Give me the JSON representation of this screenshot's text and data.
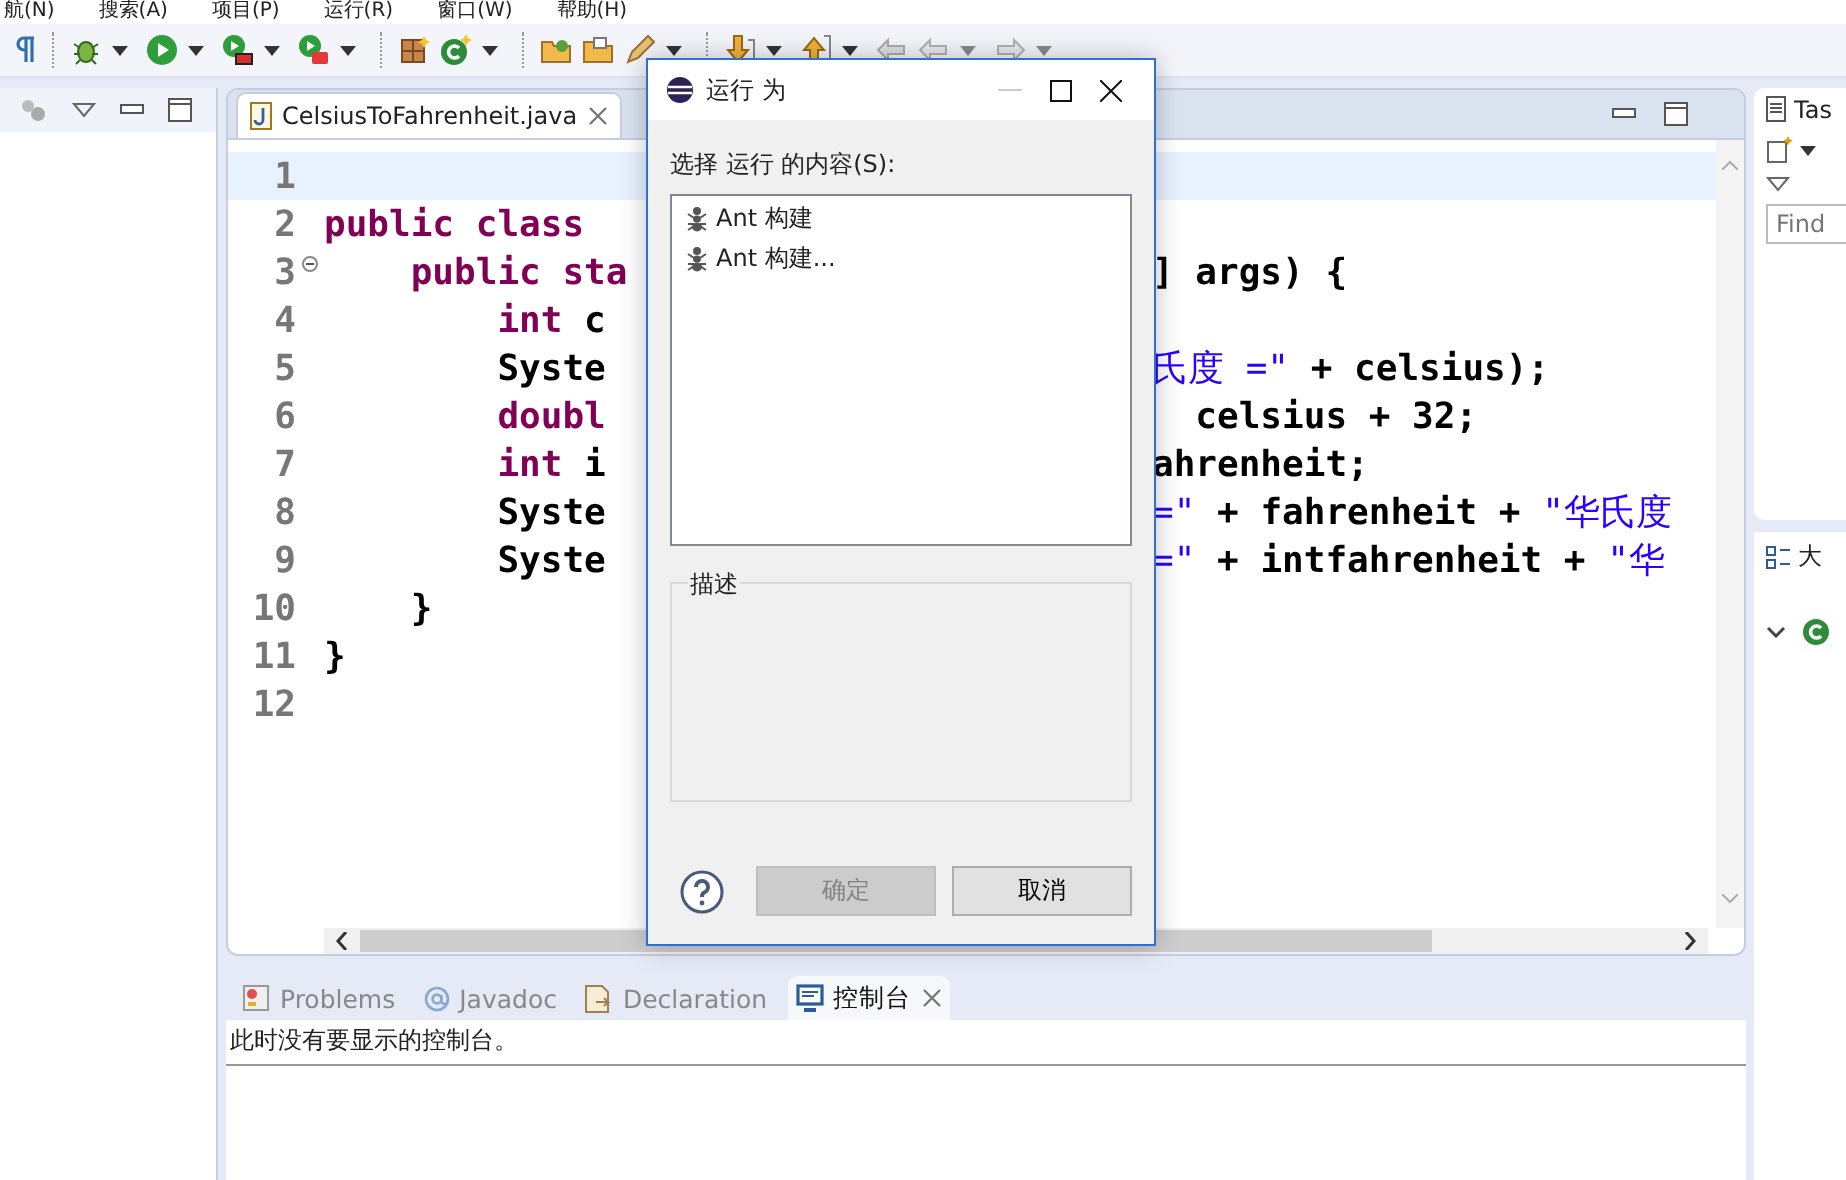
{
  "menu_bar": [
    "航(N)",
    "搜索(A)",
    "项目(P)",
    "运行(R)",
    "窗口(W)",
    "帮助(H)"
  ],
  "editor": {
    "tabs": [
      {
        "label": "CelsiusToFahrenheit.java",
        "selected": true
      }
    ],
    "lines": [
      {
        "number": "1",
        "current": true
      },
      {
        "number": "2",
        "current": false,
        "left": [
          {
            "kind": "keyword",
            "text": "public class"
          }
        ]
      },
      {
        "number": "3",
        "current": false,
        "folded": false,
        "left": [
          {
            "kind": "keyword",
            "text": "    public sta"
          }
        ],
        "right": [
          {
            "kind": "plain",
            "text": "] args) {"
          }
        ]
      },
      {
        "number": "4",
        "current": false,
        "left": [
          {
            "kind": "keyword",
            "text": "        int"
          },
          {
            "kind": "plain",
            "text": " c"
          }
        ]
      },
      {
        "number": "5",
        "current": false,
        "left": [
          {
            "kind": "plain",
            "text": "        Syste"
          }
        ],
        "right": [
          {
            "kind": "string",
            "text": "氏度 =\""
          },
          {
            "kind": "plain",
            "text": " + celsius);"
          }
        ]
      },
      {
        "number": "6",
        "current": false,
        "left": [
          {
            "kind": "keyword",
            "text": "        doubl"
          }
        ],
        "right": [
          {
            "kind": "plain",
            "text": "  celsius + 32;"
          }
        ]
      },
      {
        "number": "7",
        "current": false,
        "left": [
          {
            "kind": "keyword",
            "text": "        int"
          },
          {
            "kind": "plain",
            "text": " i"
          }
        ],
        "right": [
          {
            "kind": "plain",
            "text": "ahrenheit;"
          }
        ]
      },
      {
        "number": "8",
        "current": false,
        "left": [
          {
            "kind": "plain",
            "text": "        Syste"
          }
        ],
        "right": [
          {
            "kind": "string",
            "text": "=\""
          },
          {
            "kind": "plain",
            "text": " + fahrenheit + "
          },
          {
            "kind": "string",
            "text": "\"华氏度"
          }
        ]
      },
      {
        "number": "9",
        "current": false,
        "left": [
          {
            "kind": "plain",
            "text": "        Syste"
          }
        ],
        "right": [
          {
            "kind": "string",
            "text": "=\""
          },
          {
            "kind": "plain",
            "text": " + intfahrenheit + "
          },
          {
            "kind": "string",
            "text": "\"华"
          }
        ]
      },
      {
        "number": "10",
        "current": false,
        "left": [
          {
            "kind": "plain",
            "text": "    }"
          }
        ]
      },
      {
        "number": "11",
        "current": false,
        "left": [
          {
            "kind": "plain",
            "text": "}"
          }
        ]
      },
      {
        "number": "12",
        "current": false
      }
    ]
  },
  "right_panel": {
    "tasks_tab": "Tas",
    "find_placeholder": "Find",
    "outline_tab": "大"
  },
  "bottom_panel": {
    "tabs": [
      {
        "label": "Problems",
        "selected": false
      },
      {
        "label": "Javadoc",
        "selected": false
      },
      {
        "label": "Declaration",
        "selected": false
      },
      {
        "label": "控制台",
        "selected": true
      }
    ],
    "message": "此时没有要显示的控制台。"
  },
  "dialog": {
    "title": "运行 为",
    "prompt": "选择 运行 的内容(S):",
    "items": [
      {
        "label": "Ant 构建",
        "selected": false
      },
      {
        "label": "Ant 构建...",
        "selected": false
      }
    ],
    "description_label": "描述",
    "buttons": [
      {
        "label": "确定",
        "disabled": true
      },
      {
        "label": "取消",
        "disabled": false
      }
    ]
  }
}
